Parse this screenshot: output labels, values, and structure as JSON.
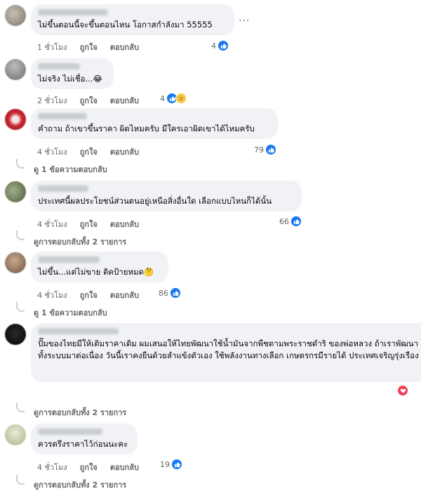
{
  "comments": [
    {
      "text": "ไม่ขึ้นตอนนี้จะขึ้นตอนไหน โอกาสกำลังมา 55555",
      "time": "1 ชั่วโมง",
      "like": "ถูกใจ",
      "reply": "ตอบกลับ",
      "count": "4"
    },
    {
      "text": "ไม่จริง ไม่เชื่อ...😂",
      "time": "2 ชั่วโมง",
      "like": "ถูกใจ",
      "reply": "ตอบกลับ",
      "count": "4"
    },
    {
      "text": "คำถาม ถ้าเขาขึ้นราคา ผิดไหมครับ มีใครเอาผิดเขาได้ไหมครับ",
      "time": "4 ชั่วโมง",
      "like": "ถูกใจ",
      "reply": "ตอบกลับ",
      "count": "79",
      "replies": "ดู 1 ข้อความตอบกลับ"
    },
    {
      "text": "ประเทศนี้ผลประโยชน์ส่วนตนอยู่เหนือสิ่งอื่นใด เลือกแบบไหนก็ได้นั้น",
      "time": "4 ชั่วโมง",
      "like": "ถูกใจ",
      "reply": "ตอบกลับ",
      "count": "66",
      "replies": "ดูการตอบกลับทั้ง 2 รายการ"
    },
    {
      "text": "ไม่ขึ้น...แต่ไม่ขาย ติดป้ายหมด🤔",
      "time": "4 ชั่วโมง",
      "like": "ถูกใจ",
      "reply": "ตอบกลับ",
      "count": "86",
      "replies": "ดู 1 ข้อความตอบกลับ"
    },
    {
      "text": "ปั๊มของไทยมีให้เติมราคาเดิม ผมเสนอให้ไทยพัฒนาใช้น้ำมันจากพืชตามพระราชดำริ ของพ่อหลวง ถ้าเราพัฒนาทั้งระบบมาต่อเนื่อง วันนี้เราคงยืนด้วยลำแข้งตัวเอง ใช้พลังงานทางเลือก เกษตรกรมีรายได้ ประเทศเจริญรุ่งเรือง",
      "replies": "ดูการตอบกลับทั้ง 2 รายการ"
    },
    {
      "text": "ควรตรึงราคาไว้ก่อนนะคะ",
      "time": "4 ชั่วโมง",
      "like": "ถูกใจ",
      "reply": "ตอบกลับ",
      "count": "19",
      "replies": "ดูการตอบกลับทั้ง 2 รายการ"
    }
  ],
  "more_label": "···",
  "colors": {
    "like": "#1877f2",
    "love": "#f33e58",
    "bubble": "#f0f2f5",
    "meta": "#65676b"
  }
}
